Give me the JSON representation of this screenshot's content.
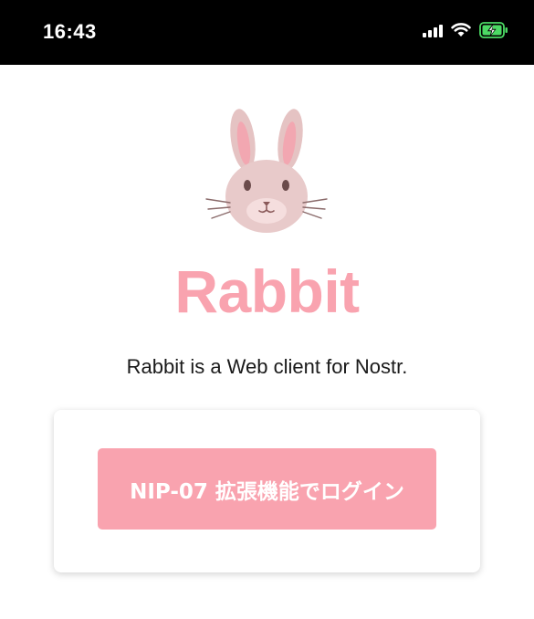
{
  "status_bar": {
    "time": "16:43",
    "icons": [
      "signal-icon",
      "wifi-icon",
      "battery-charging-icon"
    ],
    "battery_color": "#4cd964"
  },
  "app": {
    "title": "Rabbit",
    "description": "Rabbit is a Web client for Nostr.",
    "logo": "rabbit-face-icon",
    "accent_color": "#F9A3AF"
  },
  "login": {
    "button_label": "NIP-07 拡張機能でログイン"
  }
}
